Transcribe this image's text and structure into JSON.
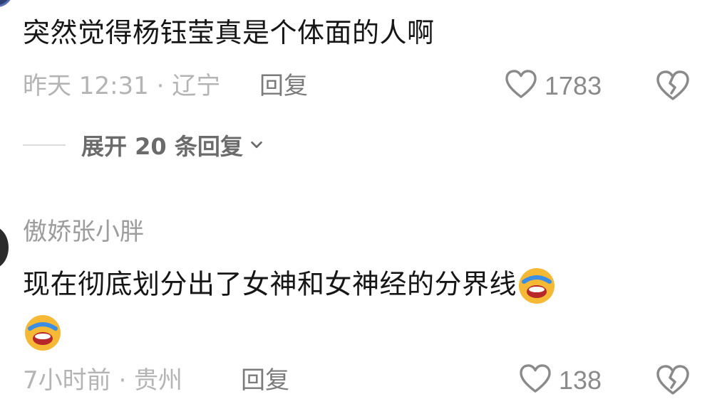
{
  "comment1": {
    "text": "突然觉得杨钰莹真是个体面的人啊",
    "time_location": "昨天 12:31 · 辽宁",
    "reply_label": "回复",
    "like_count": "1783",
    "expand_label": "展开 20 条回复"
  },
  "comment2": {
    "username": "傲娇张小胖",
    "text": "现在彻底划分出了女神和女神经的分界线",
    "emoji": "laughing-crying-emoji",
    "time_location": "7小时前 · 贵州",
    "reply_label": "回复",
    "like_count": "138"
  },
  "icons": {
    "like": "heart-outline-icon",
    "dislike": "broken-heart-icon",
    "expand": "chevron-down-icon"
  },
  "colors": {
    "text": "#161616",
    "meta": "#b4b4b4",
    "action": "#7b7b7b",
    "emoji_face": "#f5b935"
  }
}
